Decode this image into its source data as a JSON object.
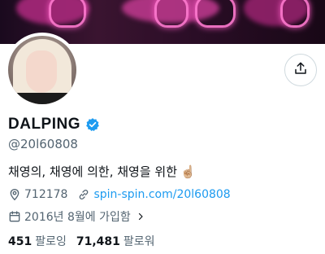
{
  "profile": {
    "display_name": "DALPING",
    "handle": "@20l60808",
    "bio": "채영의, 채영에 의한, 채영을 위한",
    "bio_emoji": "☝🏼"
  },
  "meta": {
    "location": "712178",
    "website": "spin-spin.com/20l60808",
    "joined": "2016년 8월에 가입함"
  },
  "stats": {
    "following_count": "451",
    "following_label": "팔로잉",
    "followers_count": "71,481",
    "followers_label": "팔로워"
  },
  "icons": {
    "share": "share-icon",
    "verified": "verified-badge-icon",
    "location": "location-pin-icon",
    "link": "link-icon",
    "calendar": "calendar-icon",
    "chevron": "chevron-right-icon"
  },
  "colors": {
    "accent": "#1d9bf0",
    "secondary_text": "#536471",
    "primary_text": "#0f1419"
  }
}
